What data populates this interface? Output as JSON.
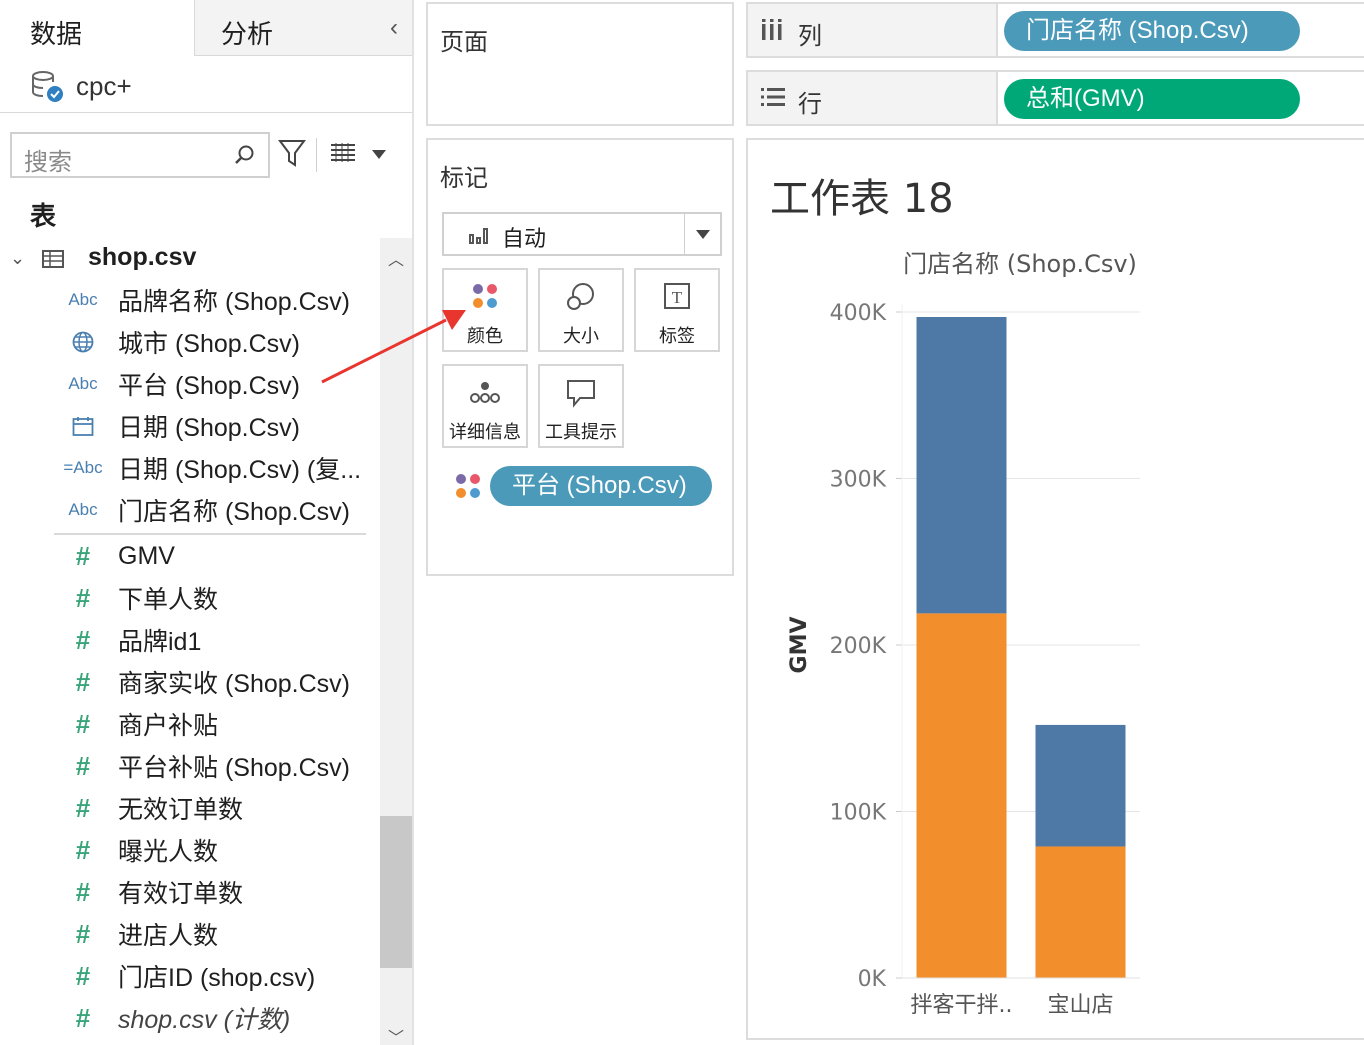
{
  "data_pane": {
    "tab_data": "数据",
    "tab_analysis": "分析",
    "datasource": "cpc+",
    "search_placeholder": "搜索",
    "tables_heading": "表",
    "table_name": "shop.csv",
    "fields": [
      {
        "icon": "Abc",
        "icon_name": "string-type-icon",
        "name": "品牌名称 (Shop.Csv)"
      },
      {
        "icon": "globe",
        "icon_name": "geo-type-icon",
        "name": "城市 (Shop.Csv)"
      },
      {
        "icon": "Abc",
        "icon_name": "string-type-icon",
        "name": "平台 (Shop.Csv)"
      },
      {
        "icon": "calendar",
        "icon_name": "date-type-icon",
        "name": "日期 (Shop.Csv)"
      },
      {
        "icon": "=Abc",
        "icon_name": "calculated-string-icon",
        "name": "日期 (Shop.Csv) (复..."
      },
      {
        "icon": "Abc",
        "icon_name": "string-type-icon",
        "name": "门店名称 (Shop.Csv)"
      }
    ],
    "measures": [
      {
        "icon": "#",
        "name": "GMV"
      },
      {
        "icon": "#",
        "name": "下单人数"
      },
      {
        "icon": "#",
        "name": "品牌id1"
      },
      {
        "icon": "#",
        "name": "商家实收 (Shop.Csv)"
      },
      {
        "icon": "#",
        "name": "商户补贴"
      },
      {
        "icon": "#",
        "name": "平台补贴 (Shop.Csv)"
      },
      {
        "icon": "#",
        "name": "无效订单数"
      },
      {
        "icon": "#",
        "name": "曝光人数"
      },
      {
        "icon": "#",
        "name": "有效订单数"
      },
      {
        "icon": "#",
        "name": "进店人数"
      },
      {
        "icon": "#",
        "name": "门店ID (shop.csv)"
      },
      {
        "icon": "#",
        "name": "shop.csv (计数)",
        "italic": true
      }
    ]
  },
  "pages_card": {
    "title": "页面"
  },
  "marks_card": {
    "title": "标记",
    "mark_type": "自动",
    "buttons": {
      "color": "颜色",
      "size": "大小",
      "label": "标签",
      "detail": "详细信息",
      "tooltip": "工具提示"
    },
    "label_icon_glyph": "T",
    "color_pill": "平台 (Shop.Csv)"
  },
  "shelves": {
    "columns_label": "列",
    "columns_pill": "门店名称 (Shop.Csv)",
    "rows_label": "行",
    "rows_pill": "总和(GMV)"
  },
  "worksheet": {
    "title": "工作表 18"
  },
  "colors": {
    "blue": "#4e79a7",
    "orange": "#f28e2b",
    "pill_blue": "#4b9ab9",
    "pill_green": "#00a878",
    "annotation_arrow": "#e8352e"
  },
  "chart_data": {
    "type": "bar",
    "stacked": true,
    "column_header": "门店名称 (Shop.Csv)",
    "categories": [
      "拌客干拌..",
      "宝山店"
    ],
    "ylabel": "GMV",
    "yticks": [
      "0K",
      "100K",
      "200K",
      "300K",
      "400K"
    ],
    "ylim": [
      0,
      400000
    ],
    "series": [
      {
        "color": "#f28e2b",
        "values": [
          219000,
          79000
        ]
      },
      {
        "color": "#4e79a7",
        "values": [
          178000,
          73000
        ]
      }
    ],
    "grid": true,
    "legend": "none"
  }
}
